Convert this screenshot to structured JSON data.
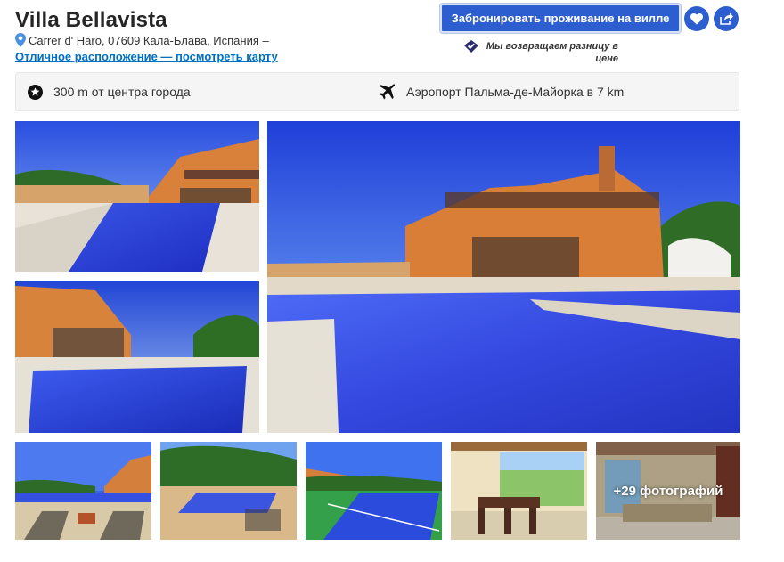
{
  "hotel": {
    "name": "Villa Bellavista",
    "address": "Carrer d' Haro, 07609 Кала-Блава, Испания –",
    "map_link": "Отличное расположение — посмотреть карту"
  },
  "actions": {
    "book_label": "Забронировать проживание на вилле",
    "favorite_icon": "heart-icon",
    "share_icon": "share-icon"
  },
  "price_match": {
    "text": "Мы возвращаем разницу в цене"
  },
  "info": {
    "center_distance": "300 m от центра города",
    "airport": "Аэропорт Пальма-де-Майорка в 7 km"
  },
  "gallery": {
    "more_photos": "+29 фотографий"
  },
  "colors": {
    "brand": "#2d5ecf",
    "link": "#0071c2",
    "info_bg": "#f5f5f5"
  }
}
